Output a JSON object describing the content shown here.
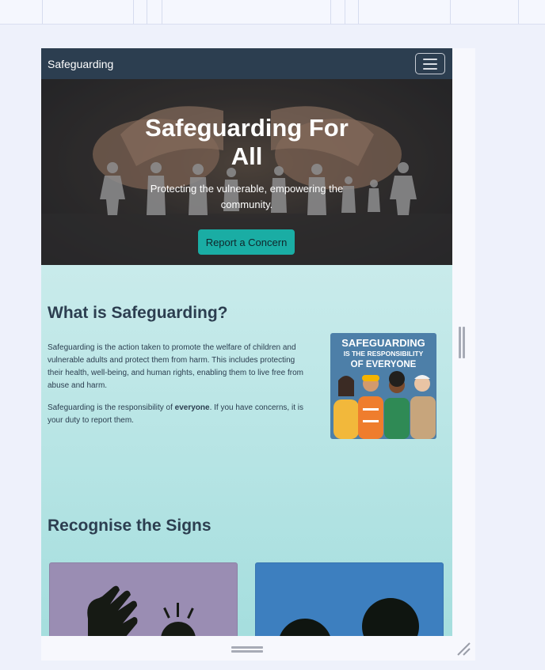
{
  "navbar": {
    "brand": "Safeguarding"
  },
  "hero": {
    "title": "Safeguarding For All",
    "subtitle": "Protecting the vulnerable, empowering the community.",
    "cta_label": "Report a Concern"
  },
  "about": {
    "heading": "What is Safeguarding?",
    "paragraph1": "Safeguarding is the action taken to promote the welfare of children and vulnerable adults and protect them from harm. This includes protecting their health, well-being, and human rights, enabling them to live free from abuse and harm.",
    "paragraph2_before": "Safeguarding is the responsibility of ",
    "paragraph2_bold": "everyone",
    "paragraph2_after": ". If you have concerns, it is your duty to report them.",
    "poster": {
      "line1": "SAFEGUARDING",
      "line2": "IS THE RESPONSIBILITY",
      "line3": "OF EVERYONE"
    }
  },
  "signs": {
    "heading": "Recognise the Signs"
  },
  "colors": {
    "navbar": "#2c3e50",
    "accent": "#1aada4",
    "content_bg": "#c9ebeb",
    "card_purple": "#9a8db3",
    "card_blue": "#3d7fbf"
  }
}
